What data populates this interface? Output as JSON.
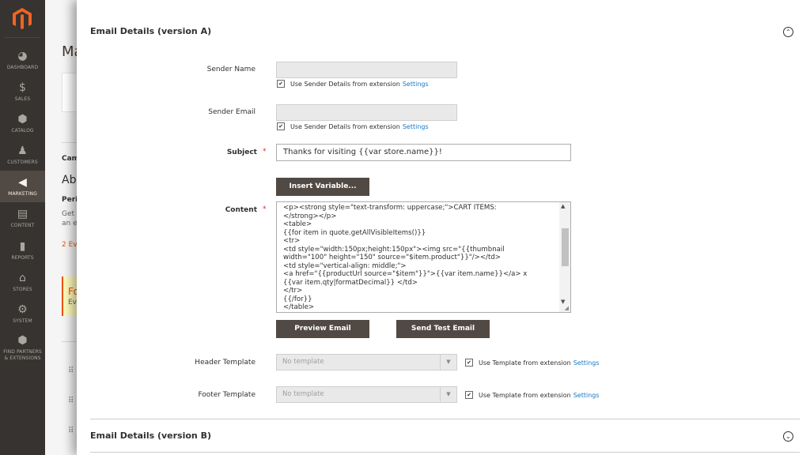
{
  "nav": {
    "items": [
      {
        "label": "DASHBOARD",
        "icon": "dashboard-icon"
      },
      {
        "label": "SALES",
        "icon": "dollar-icon"
      },
      {
        "label": "CATALOG",
        "icon": "cube-icon"
      },
      {
        "label": "CUSTOMERS",
        "icon": "person-icon"
      },
      {
        "label": "MARKETING",
        "icon": "megaphone-icon"
      },
      {
        "label": "CONTENT",
        "icon": "content-icon"
      },
      {
        "label": "REPORTS",
        "icon": "bar-chart-icon"
      },
      {
        "label": "STORES",
        "icon": "store-icon"
      },
      {
        "label": "SYSTEM",
        "icon": "gear-icon"
      },
      {
        "label": "FIND PARTNERS & EXTENSIONS",
        "icon": "partners-icon"
      }
    ]
  },
  "background": {
    "title": "Ma",
    "cam": "Cam",
    "ab": "Ab",
    "peri": "Peri",
    "get": "Get l",
    "ane": "an e",
    "events": "2 Ev",
    "fo": "Fo",
    "ev": "Ev"
  },
  "sectionA": {
    "title": "Email Details (version A)",
    "sender_name_label": "Sender Name",
    "sender_email_label": "Sender Email",
    "use_sender_label": "Use Sender Details from extension",
    "settings_link": "Settings",
    "subject_label": "Subject",
    "subject_value": "Thanks for visiting {{var store.name}}!",
    "insert_variable": "Insert Variable...",
    "content_label": "Content",
    "content_code": "<p><strong style=\"text-transform: uppercase;\">CART ITEMS:\n</strong></p>\n<table>\n{{for item in quote.getAllVisibleItems()}}\n<tr>\n<td style=\"width:150px;height:150px\"><img src=\"{{thumbnail\nwidth=\"100\" height=\"150\" source=\"$item.product\"}}\"/></td>\n<td style=\"vertical-align: middle;\">\n<a href=\"{{productUrl source=\"$item\"}}\">{{var item.name}}</a> x\n{{var item.qty|formatDecimal}} </td>\n</tr>\n{{/for}}\n</table>",
    "preview_email": "Preview Email",
    "send_test_email": "Send Test Email",
    "header_template_label": "Header Template",
    "footer_template_label": "Footer Template",
    "template_placeholder": "No template",
    "use_template_label": "Use Template from extension"
  },
  "sectionB": {
    "title": "Email Details (version B)"
  }
}
